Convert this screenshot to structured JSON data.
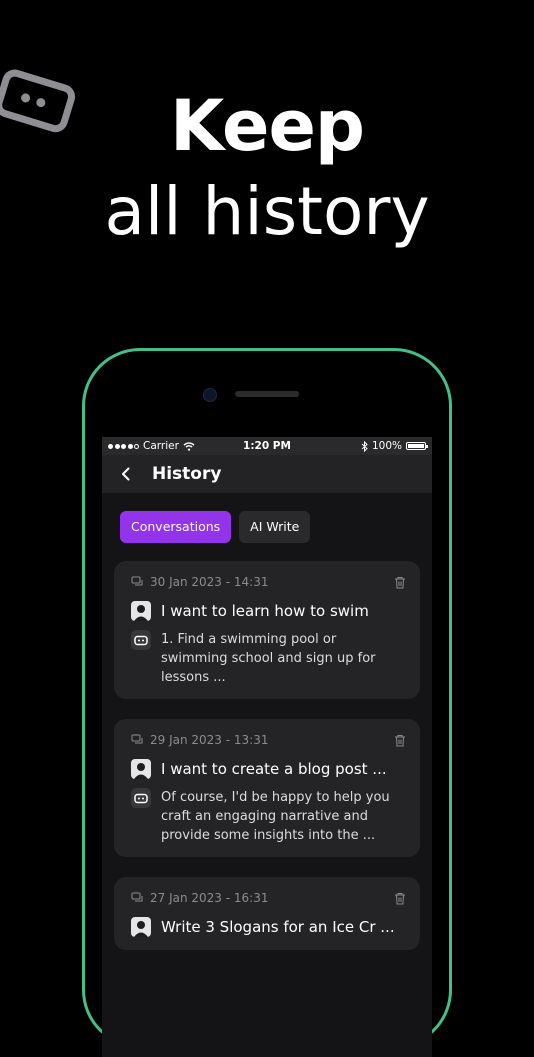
{
  "hero": {
    "line1": "Keep",
    "line2": "all history"
  },
  "status_bar": {
    "carrier": "Carrier",
    "time": "1:20 PM",
    "battery": "100%",
    "battery_level": 1.0
  },
  "nav": {
    "title": "History"
  },
  "tabs": [
    {
      "label": "Conversations",
      "active": true
    },
    {
      "label": "AI Write",
      "active": false
    }
  ],
  "conversations": [
    {
      "date": "30 Jan 2023 - 14:31",
      "question": "I want to learn how to swim",
      "answer": "1. Find a swimming pool or swimming school and sign up for lessons ..."
    },
    {
      "date": "29 Jan 2023 - 13:31",
      "question": "I want to create a blog post ...",
      "answer": "Of course, I'd be happy to help you craft an engaging narrative and provide some insights into the  ..."
    },
    {
      "date": "27 Jan 2023 - 16:31",
      "question": "Write 3 Slogans for an Ice Cr ...",
      "answer": ""
    }
  ],
  "colors": {
    "accent": "#9333ea",
    "phone_frame": "#43c08a",
    "card": "#242427",
    "background": "#000000"
  }
}
